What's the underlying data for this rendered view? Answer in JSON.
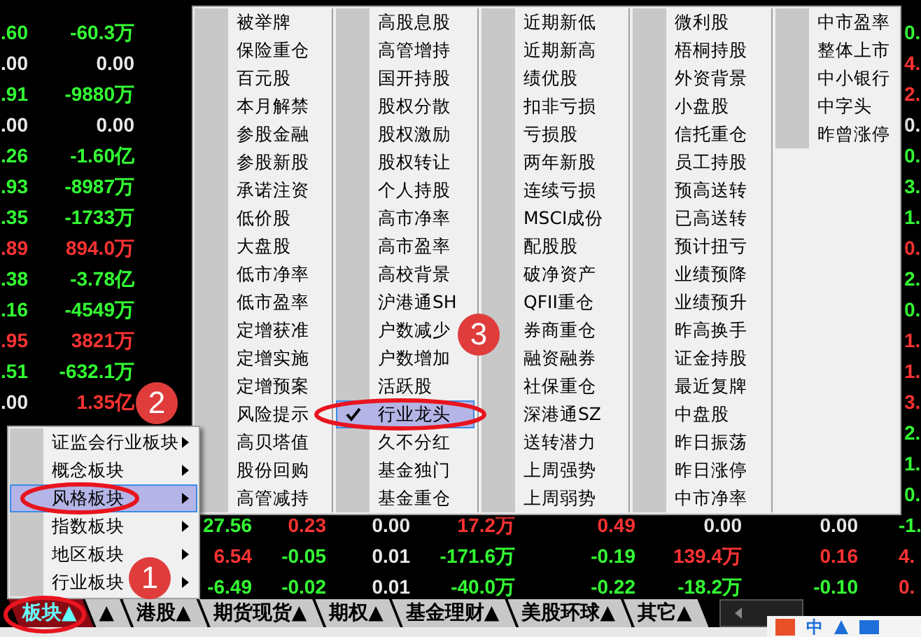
{
  "quotes": {
    "rows": [
      {
        "kind": "edge",
        "cells": [
          {
            "text": ".60",
            "color": "#33ff33"
          },
          {
            "text": "-60.3万",
            "color": "#33ff33"
          },
          {
            "text": "0.",
            "color": "#33ff33"
          }
        ]
      },
      {
        "kind": "edge",
        "cells": [
          {
            "text": ".00",
            "color": "#e8e8e8"
          },
          {
            "text": "0.00",
            "color": "#e8e8e8"
          },
          {
            "text": "4.",
            "color": "#ff3333"
          }
        ]
      },
      {
        "kind": "edge",
        "cells": [
          {
            "text": ".91",
            "color": "#33ff33"
          },
          {
            "text": "-9880万",
            "color": "#33ff33"
          },
          {
            "text": "2.",
            "color": "#ff3333"
          }
        ]
      },
      {
        "kind": "edge",
        "cells": [
          {
            "text": ".00",
            "color": "#e8e8e8"
          },
          {
            "text": "0.00",
            "color": "#e8e8e8"
          },
          {
            "text": "0.",
            "color": "#e8e8e8"
          }
        ]
      },
      {
        "kind": "edge",
        "cells": [
          {
            "text": ".26",
            "color": "#33ff33"
          },
          {
            "text": "-1.60亿",
            "color": "#33ff33"
          },
          {
            "text": "0.",
            "color": "#33ff33"
          }
        ]
      },
      {
        "kind": "edge",
        "cells": [
          {
            "text": ".93",
            "color": "#33ff33"
          },
          {
            "text": "-8987万",
            "color": "#33ff33"
          },
          {
            "text": "3.",
            "color": "#33ff33"
          }
        ]
      },
      {
        "kind": "edge",
        "cells": [
          {
            "text": ".35",
            "color": "#33ff33"
          },
          {
            "text": "-1733万",
            "color": "#33ff33"
          },
          {
            "text": "1.",
            "color": "#33ff33"
          }
        ]
      },
      {
        "kind": "edge",
        "cells": [
          {
            "text": ".89",
            "color": "#ff3333"
          },
          {
            "text": "894.0万",
            "color": "#ff3333"
          },
          {
            "text": "0.",
            "color": "#ff3333"
          }
        ]
      },
      {
        "kind": "edge",
        "cells": [
          {
            "text": ".38",
            "color": "#33ff33"
          },
          {
            "text": "-3.78亿",
            "color": "#33ff33"
          },
          {
            "text": "2.",
            "color": "#33ff33"
          }
        ]
      },
      {
        "kind": "edge",
        "cells": [
          {
            "text": ".16",
            "color": "#33ff33"
          },
          {
            "text": "-4549万",
            "color": "#33ff33"
          },
          {
            "text": "0.",
            "color": "#33ff33"
          }
        ]
      },
      {
        "kind": "edge",
        "cells": [
          {
            "text": ".95",
            "color": "#ff3333"
          },
          {
            "text": "3821万",
            "color": "#ff3333"
          },
          {
            "text": "1.",
            "color": "#ff3333"
          }
        ]
      },
      {
        "kind": "edge",
        "cells": [
          {
            "text": ".51",
            "color": "#33ff33"
          },
          {
            "text": "-632.1万",
            "color": "#33ff33"
          },
          {
            "text": "1.",
            "color": "#ff3333"
          }
        ]
      },
      {
        "kind": "edge",
        "cells": [
          {
            "text": ".00",
            "color": "#e8e8e8"
          },
          {
            "text": "1.35亿",
            "color": "#ff3333"
          },
          {
            "text": "3.",
            "color": "#ff3333"
          }
        ]
      },
      {
        "kind": "right",
        "cells": [
          {
            "text": "2.",
            "color": "#33ff33"
          }
        ]
      },
      {
        "kind": "right",
        "cells": [
          {
            "text": "1.",
            "color": "#33ff33"
          }
        ]
      },
      {
        "kind": "right",
        "cells": [
          {
            "text": "0.",
            "color": "#33ff33"
          }
        ]
      },
      {
        "kind": "full",
        "cells": [
          {
            "text": "27.56",
            "color": "#33ff33"
          },
          {
            "text": "0.23",
            "color": "#ff3333"
          },
          {
            "text": "0.00",
            "color": "#e8e8e8"
          },
          {
            "text": "17.2万",
            "color": "#ff3333"
          },
          {
            "text": "0.49",
            "color": "#ff3333"
          },
          {
            "text": "0.00",
            "color": "#e8e8e8"
          },
          {
            "text": "0.00",
            "color": "#e8e8e8"
          },
          {
            "text": "-1.",
            "color": "#33ff33"
          }
        ]
      },
      {
        "kind": "full",
        "cells": [
          {
            "text": "6.54",
            "color": "#ff3333"
          },
          {
            "text": "-0.05",
            "color": "#33ff33"
          },
          {
            "text": "0.01",
            "color": "#e8e8e8"
          },
          {
            "text": "-171.6万",
            "color": "#33ff33"
          },
          {
            "text": "-0.19",
            "color": "#33ff33"
          },
          {
            "text": "139.4万",
            "color": "#ff3333"
          },
          {
            "text": "0.16",
            "color": "#ff3333"
          },
          {
            "text": "4.",
            "color": "#ff3333"
          }
        ]
      },
      {
        "kind": "full",
        "cells": [
          {
            "text": "-6.49",
            "color": "#33ff33"
          },
          {
            "text": "-0.02",
            "color": "#33ff33"
          },
          {
            "text": "0.01",
            "color": "#e8e8e8"
          },
          {
            "text": "-40.0万",
            "color": "#33ff33"
          },
          {
            "text": "-0.22",
            "color": "#33ff33"
          },
          {
            "text": "-18.2万",
            "color": "#33ff33"
          },
          {
            "text": "-0.10",
            "color": "#33ff33"
          },
          {
            "text": "0.",
            "color": "#ff3333"
          }
        ]
      }
    ]
  },
  "category_menu": {
    "items": [
      {
        "label": "证监会行业板块",
        "selected": false
      },
      {
        "label": "概念板块",
        "selected": false
      },
      {
        "label": "风格板块",
        "selected": true
      },
      {
        "label": "指数板块",
        "selected": false
      },
      {
        "label": "地区板块",
        "selected": false
      },
      {
        "label": "行业板块",
        "selected": false
      }
    ]
  },
  "style_menu": {
    "columns": [
      {
        "items": [
          {
            "label": "被举牌",
            "checked": false,
            "selected": false
          },
          {
            "label": "保险重仓",
            "checked": false,
            "selected": false
          },
          {
            "label": "百元股",
            "checked": false,
            "selected": false
          },
          {
            "label": "本月解禁",
            "checked": false,
            "selected": false
          },
          {
            "label": "参股金融",
            "checked": false,
            "selected": false
          },
          {
            "label": "参股新股",
            "checked": false,
            "selected": false
          },
          {
            "label": "承诺注资",
            "checked": false,
            "selected": false
          },
          {
            "label": "低价股",
            "checked": false,
            "selected": false
          },
          {
            "label": "大盘股",
            "checked": false,
            "selected": false
          },
          {
            "label": "低市净率",
            "checked": false,
            "selected": false
          },
          {
            "label": "低市盈率",
            "checked": false,
            "selected": false
          },
          {
            "label": "定增获准",
            "checked": false,
            "selected": false
          },
          {
            "label": "定增实施",
            "checked": false,
            "selected": false
          },
          {
            "label": "定增预案",
            "checked": false,
            "selected": false
          },
          {
            "label": "风险提示",
            "checked": false,
            "selected": false
          },
          {
            "label": "高贝塔值",
            "checked": false,
            "selected": false
          },
          {
            "label": "股份回购",
            "checked": false,
            "selected": false
          },
          {
            "label": "高管减持",
            "checked": false,
            "selected": false
          }
        ]
      },
      {
        "items": [
          {
            "label": "高股息股",
            "checked": false,
            "selected": false
          },
          {
            "label": "高管增持",
            "checked": false,
            "selected": false
          },
          {
            "label": "国开持股",
            "checked": false,
            "selected": false
          },
          {
            "label": "股权分散",
            "checked": false,
            "selected": false
          },
          {
            "label": "股权激励",
            "checked": false,
            "selected": false
          },
          {
            "label": "股权转让",
            "checked": false,
            "selected": false
          },
          {
            "label": "个人持股",
            "checked": false,
            "selected": false
          },
          {
            "label": "高市净率",
            "checked": false,
            "selected": false
          },
          {
            "label": "高市盈率",
            "checked": false,
            "selected": false
          },
          {
            "label": "高校背景",
            "checked": false,
            "selected": false
          },
          {
            "label": "沪港通SH",
            "checked": false,
            "selected": false
          },
          {
            "label": "户数减少",
            "checked": false,
            "selected": false
          },
          {
            "label": "户数增加",
            "checked": false,
            "selected": false
          },
          {
            "label": "活跃股",
            "checked": false,
            "selected": false
          },
          {
            "label": "行业龙头",
            "checked": true,
            "selected": true
          },
          {
            "label": "久不分红",
            "checked": false,
            "selected": false
          },
          {
            "label": "基金独门",
            "checked": false,
            "selected": false
          },
          {
            "label": "基金重仓",
            "checked": false,
            "selected": false
          }
        ]
      },
      {
        "items": [
          {
            "label": "近期新低",
            "checked": false,
            "selected": false
          },
          {
            "label": "近期新高",
            "checked": false,
            "selected": false
          },
          {
            "label": "绩优股",
            "checked": false,
            "selected": false
          },
          {
            "label": "扣非亏损",
            "checked": false,
            "selected": false
          },
          {
            "label": "亏损股",
            "checked": false,
            "selected": false
          },
          {
            "label": "两年新股",
            "checked": false,
            "selected": false
          },
          {
            "label": "连续亏损",
            "checked": false,
            "selected": false
          },
          {
            "label": "MSCI成份",
            "checked": false,
            "selected": false
          },
          {
            "label": "配股股",
            "checked": false,
            "selected": false
          },
          {
            "label": "破净资产",
            "checked": false,
            "selected": false
          },
          {
            "label": "QFII重仓",
            "checked": false,
            "selected": false
          },
          {
            "label": "券商重仓",
            "checked": false,
            "selected": false
          },
          {
            "label": "融资融券",
            "checked": false,
            "selected": false
          },
          {
            "label": "社保重仓",
            "checked": false,
            "selected": false
          },
          {
            "label": "深港通SZ",
            "checked": false,
            "selected": false
          },
          {
            "label": "送转潜力",
            "checked": false,
            "selected": false
          },
          {
            "label": "上周强势",
            "checked": false,
            "selected": false
          },
          {
            "label": "上周弱势",
            "checked": false,
            "selected": false
          }
        ]
      },
      {
        "items": [
          {
            "label": "微利股",
            "checked": false,
            "selected": false
          },
          {
            "label": "梧桐持股",
            "checked": false,
            "selected": false
          },
          {
            "label": "外资背景",
            "checked": false,
            "selected": false
          },
          {
            "label": "小盘股",
            "checked": false,
            "selected": false
          },
          {
            "label": "信托重仓",
            "checked": false,
            "selected": false
          },
          {
            "label": "员工持股",
            "checked": false,
            "selected": false
          },
          {
            "label": "预高送转",
            "checked": false,
            "selected": false
          },
          {
            "label": "已高送转",
            "checked": false,
            "selected": false
          },
          {
            "label": "预计扭亏",
            "checked": false,
            "selected": false
          },
          {
            "label": "业绩预降",
            "checked": false,
            "selected": false
          },
          {
            "label": "业绩预升",
            "checked": false,
            "selected": false
          },
          {
            "label": "昨高换手",
            "checked": false,
            "selected": false
          },
          {
            "label": "证金持股",
            "checked": false,
            "selected": false
          },
          {
            "label": "最近复牌",
            "checked": false,
            "selected": false
          },
          {
            "label": "中盘股",
            "checked": false,
            "selected": false
          },
          {
            "label": "昨日振荡",
            "checked": false,
            "selected": false
          },
          {
            "label": "昨日涨停",
            "checked": false,
            "selected": false
          },
          {
            "label": "中市净率",
            "checked": false,
            "selected": false
          }
        ]
      },
      {
        "items": [
          {
            "label": "中市盈率",
            "checked": false,
            "selected": false
          },
          {
            "label": "整体上市",
            "checked": false,
            "selected": false
          },
          {
            "label": "中小银行",
            "checked": false,
            "selected": false
          },
          {
            "label": "中字头",
            "checked": false,
            "selected": false
          },
          {
            "label": "昨曾涨停",
            "checked": false,
            "selected": false
          }
        ]
      }
    ]
  },
  "tabs": [
    {
      "label": "板块▲",
      "selected": true
    },
    {
      "label": "▲",
      "selected": false
    },
    {
      "label": "港股▲",
      "selected": false
    },
    {
      "label": "期货现货▲",
      "selected": false
    },
    {
      "label": "期权▲",
      "selected": false
    },
    {
      "label": "基金理财▲",
      "selected": false
    },
    {
      "label": "美股环球▲",
      "selected": false
    },
    {
      "label": "其它▲",
      "selected": false
    }
  ],
  "ime_bar": {
    "mode": "中"
  },
  "annotations": [
    {
      "number": "1"
    },
    {
      "number": "2"
    },
    {
      "number": "3"
    }
  ]
}
